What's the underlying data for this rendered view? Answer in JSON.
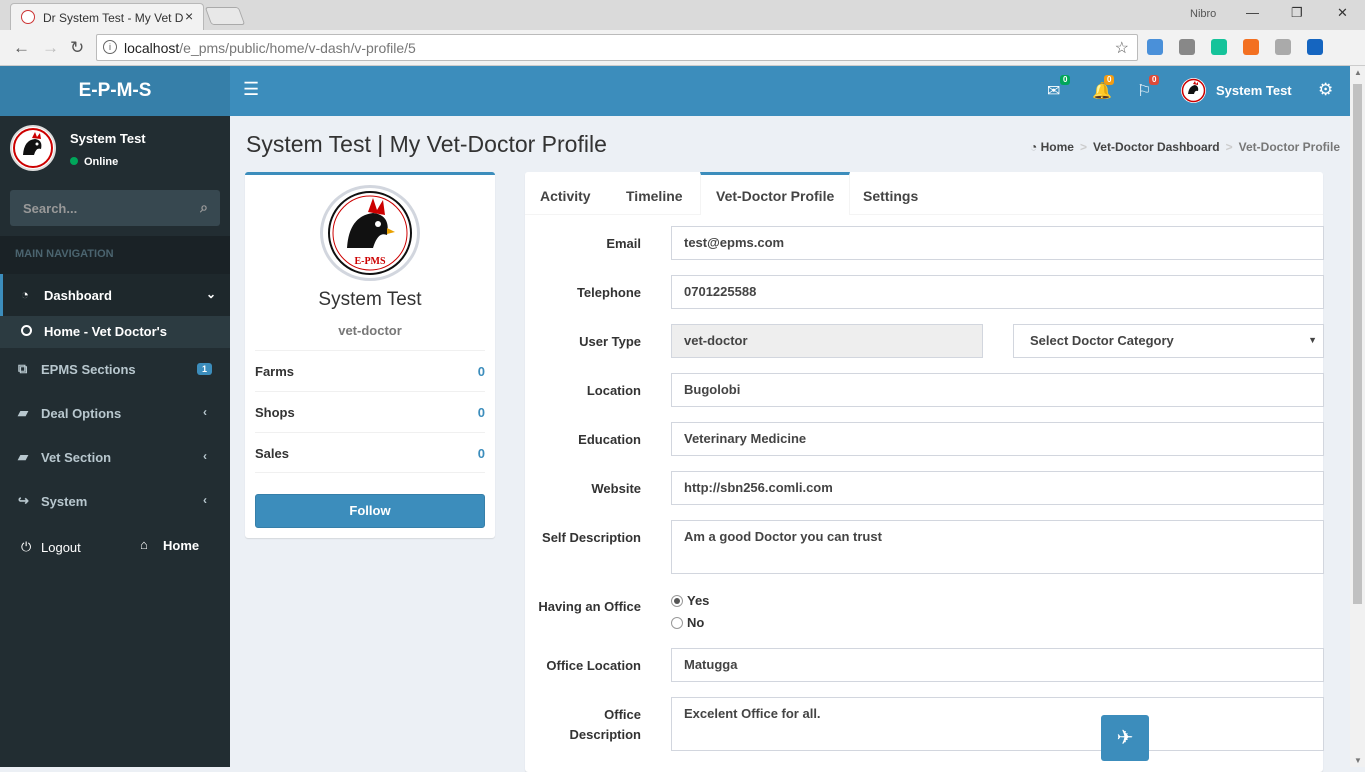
{
  "browser": {
    "tab_title": "Dr System Test - My Vet D",
    "tab_close": "×",
    "window_user": "Nibro",
    "url_host": "localhost",
    "url_path": "/e_pms/public/home/v-dash/v-profile/5",
    "back": "←",
    "forward": "→",
    "reload": "↻",
    "info": "i",
    "star": "☆",
    "win_min": "—",
    "win_max": "❐",
    "win_close": "✕",
    "ext_colors": [
      "#4a90d9",
      "#888888",
      "#15c39a",
      "#f37021",
      "#aaaaaa",
      "#1565c0"
    ]
  },
  "header": {
    "logo": "E-P-M-S",
    "menu_icon": "☰",
    "messages_icon": "✉",
    "messages_count": "0",
    "notifications_icon": "🔔",
    "notifications_count": "0",
    "flags_icon": "⚐",
    "flags_count": "0",
    "user_name": "System Test",
    "settings_icon": "⚙",
    "colors": {
      "success": "#00a65a",
      "warning": "#f39c12",
      "danger": "#dd4b39"
    }
  },
  "sidebar": {
    "user_name": "System Test",
    "status": "Online",
    "search_placeholder": "Search...",
    "search_icon": "⌕",
    "section_header": "MAIN NAVIGATION",
    "items": [
      {
        "icon": "◔",
        "label": "Dashboard",
        "chevron": "⌄"
      },
      {
        "icon": "⧉",
        "label": "EPMS Sections",
        "badge": "1"
      },
      {
        "icon": "▰",
        "label": "Deal Options",
        "chevron": "‹"
      },
      {
        "icon": "▰",
        "label": "Vet Section",
        "chevron": "‹"
      },
      {
        "icon": "↪",
        "label": "System",
        "chevron": "‹"
      }
    ],
    "subitem": "Home - Vet Doctor's",
    "logout_icon": "⏻",
    "logout": "Logout",
    "home_icon": "⌂",
    "home": "Home"
  },
  "page": {
    "title": "System Test | My Vet-Doctor Profile",
    "breadcrumb": [
      "Home",
      "Vet-Doctor Dashboard",
      "Vet-Doctor Profile"
    ],
    "breadcrumb_icon": "◔",
    "breadcrumb_sep": ">"
  },
  "profile": {
    "logo_text": "E-PMS",
    "name": "System Test",
    "role": "vet-doctor",
    "stats": [
      {
        "label": "Farms",
        "value": "0"
      },
      {
        "label": "Shops",
        "value": "0"
      },
      {
        "label": "Sales",
        "value": "0"
      }
    ],
    "follow": "Follow"
  },
  "tabs": [
    "Activity",
    "Timeline",
    "Vet-Doctor Profile",
    "Settings"
  ],
  "form": {
    "email_label": "Email",
    "email": "test@epms.com",
    "telephone_label": "Telephone",
    "telephone": "0701225588",
    "user_type_label": "User Type",
    "user_type": "vet-doctor",
    "doctor_category": "Select Doctor Category",
    "select_arrow": "▼",
    "location_label": "Location",
    "location": "Bugolobi",
    "education_label": "Education",
    "education": "Veterinary Medicine",
    "website_label": "Website",
    "website": "http://sbn256.comli.com",
    "self_desc_label": "Self Description",
    "self_desc": "Am a good Doctor you can trust",
    "office_label": "Having an Office",
    "office_yes": "Yes",
    "office_no": "No",
    "office_location_label": "Office Location",
    "office_location": "Matugga",
    "office_desc_label_1": "Office",
    "office_desc_label_2": "Description",
    "office_desc": "Excelent Office for all."
  },
  "fab_icon": "✈",
  "scroll_up": "▲",
  "scroll_down": "▼"
}
